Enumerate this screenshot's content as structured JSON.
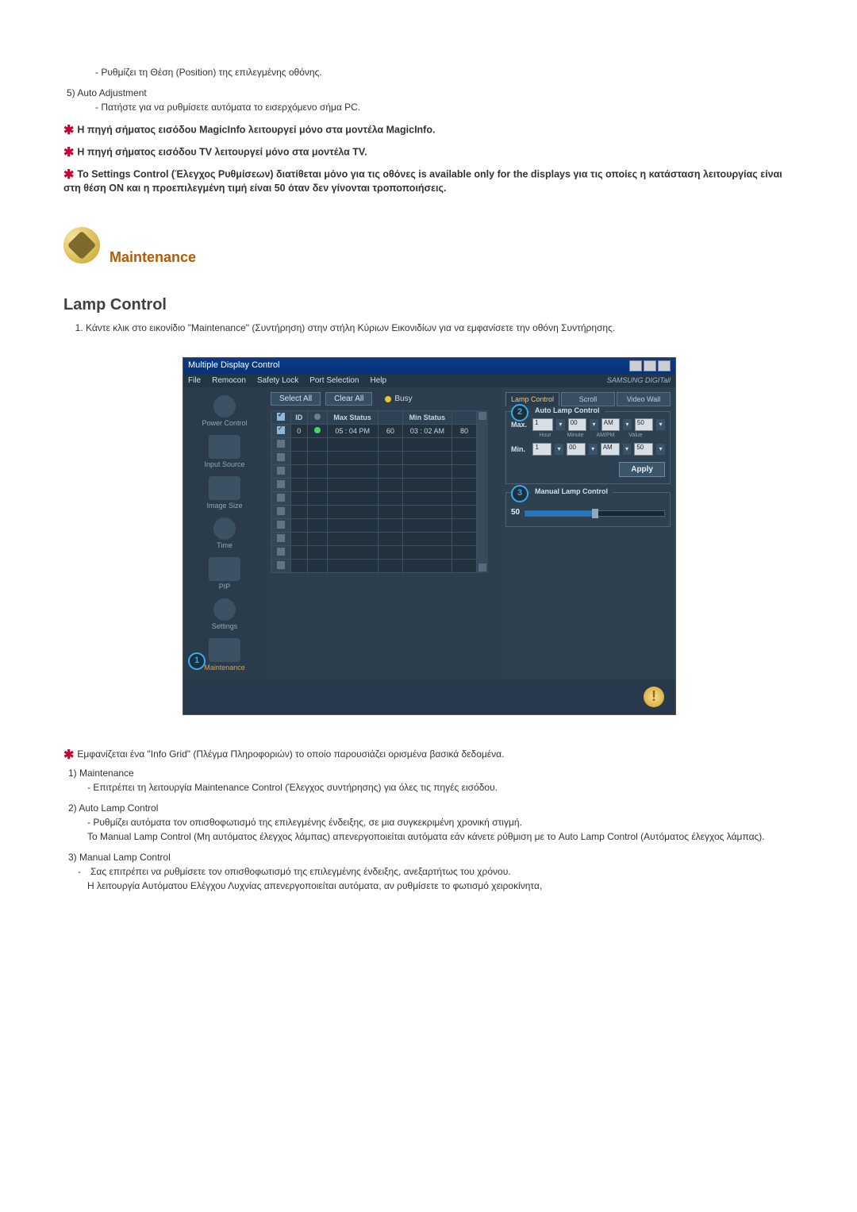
{
  "top": {
    "dash1": "- Ρυθμίζει τη Θέση (Position) της επιλεγμένης οθόνης.",
    "item5_num": "5)",
    "item5_label": "Auto Adjustment",
    "dash5": "- Πατήστε για να ρυθμίσετε αυτόματα το εισερχόμενο σήμα PC.",
    "star1": "Η πηγή σήματος εισόδου MagicInfo λειτουργεί μόνο στα μοντέλα MagicInfo.",
    "star2": "Η πηγή σήματος εισόδου TV λειτουργεί μόνο στα μοντέλα TV.",
    "star3": "Το Settings Control (Έλεγχος Ρυθμίσεων) διατίθεται μόνο για τις οθόνες is available only for the displays για τις οποίες η κατάσταση λειτουργίας είναι στη θέση ON και η προεπιλεγμένη τιμή είναι 50 όταν δεν γίνονται τροποποιήσεις."
  },
  "section": {
    "title": "Maintenance",
    "subtitle": "Lamp Control",
    "intro": "Κάντε κλικ στο εικονίδιο \"Maintenance\" (Συντήρηση) στην στήλη Κύριων Εικονιδίων για να εμφανίσετε την οθόνη Συντήρησης."
  },
  "app": {
    "title": "Multiple Display Control",
    "menus": [
      "File",
      "Remocon",
      "Safety Lock",
      "Port Selection",
      "Help"
    ],
    "brand": "SAMSUNG DIGITall",
    "select_all": "Select All",
    "clear_all": "Clear All",
    "busy": "Busy",
    "sidebar": [
      "Power Control",
      "Input Source",
      "Image Size",
      "Time",
      "PIP",
      "Settings",
      "Maintenance"
    ],
    "badge1": "1",
    "grid": {
      "headers": [
        "",
        "ID",
        "",
        "Max Status",
        "",
        "Min Status",
        ""
      ],
      "row1": [
        "0",
        "05 : 04 PM",
        "60",
        "03 : 02 AM",
        "80"
      ]
    },
    "tabs_right": [
      "Lamp Control",
      "Scroll",
      "Video Wall"
    ],
    "auto_box": {
      "title": "Auto Lamp Control",
      "badge": "2",
      "max": "Max.",
      "min": "Min.",
      "hour_label": "Hour",
      "minute_label": "Minute",
      "ampm_label": "AM/PM",
      "value_label": "Value",
      "hour1": "1",
      "min00": "00",
      "ampm": "AM",
      "val50": "50",
      "apply": "Apply"
    },
    "manual_box": {
      "title": "Manual Lamp Control",
      "badge": "3",
      "value": "50"
    }
  },
  "bottom": {
    "star": "Εμφανίζεται ένα \"Info Grid\" (Πλέγμα Πληροφοριών) το οποίο παρουσιάζει ορισμένα βασικά δεδομένα.",
    "n1": "1)",
    "l1": "Maintenance",
    "d1": "- Επιτρέπει τη λειτουργία Maintenance Control (Έλεγχος συντήρησης) για όλες τις πηγές εισόδου.",
    "n2": "2)",
    "l2": "Auto Lamp Control",
    "d2a": "- Ρυθμίζει αυτόματα τον οπισθοφωτισμό της επιλεγμένης ένδειξης, σε μια συγκεκριμένη χρονική στιγμή.",
    "d2b": "Το Manual Lamp Control (Μη αυτόματος έλεγχος λάμπας) απενεργοποιείται αυτόματα εάν κάνετε ρύθμιση με το Auto Lamp Control (Αυτόματος έλεγχος λάμπας).",
    "n3": "3)",
    "l3": "Manual Lamp Control",
    "d3a": "Σας επιτρέπει να ρυθμίσετε τον οπισθοφωτισμό της επιλεγμένης ένδειξης, ανεξαρτήτως του χρόνου.",
    "d3b": "Η λειτουργία Αυτόματου Ελέγχου Λυχνίας απενεργοποιείται αυτόματα, αν ρυθμίσετε το φωτισμό χειροκίνητα,"
  }
}
